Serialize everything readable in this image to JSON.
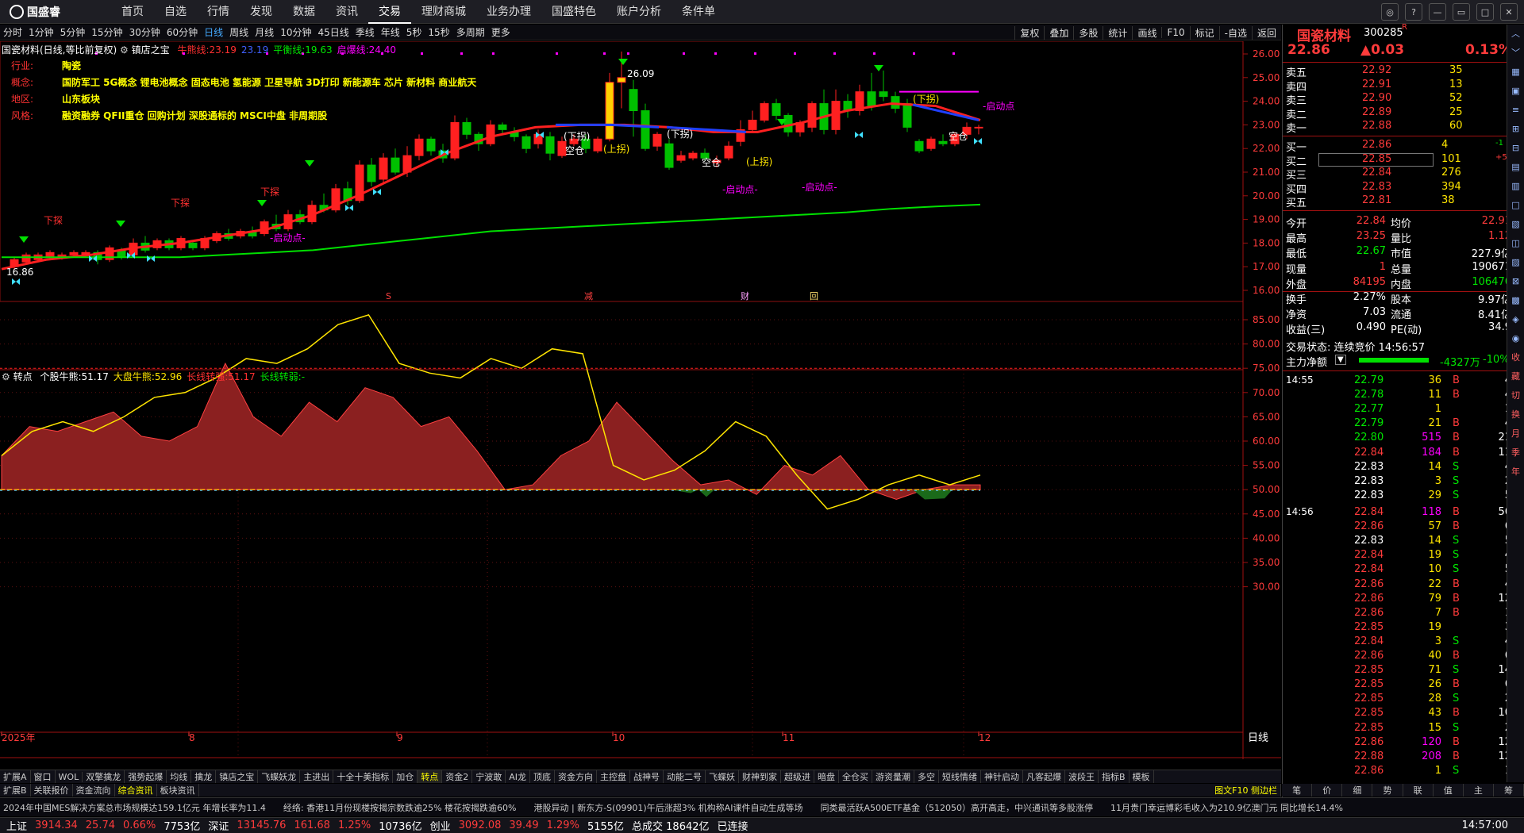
{
  "app": {
    "name": "国盛睿"
  },
  "nav": [
    "首页",
    "自选",
    "行情",
    "发现",
    "数据",
    "资讯",
    "交易",
    "理财商城",
    "业务办理",
    "国盛特色",
    "账户分析",
    "条件单"
  ],
  "nav_active": 6,
  "window_controls": [
    "chat-icon",
    "help-icon",
    "minimize-icon",
    "restore-icon",
    "maximize-icon",
    "close-icon"
  ],
  "periods": [
    "分时",
    "1分钟",
    "5分钟",
    "15分钟",
    "30分钟",
    "60分钟",
    "日线",
    "周线",
    "月线",
    "10分钟",
    "45日线",
    "季线",
    "年线",
    "5秒",
    "15秒",
    "多周期",
    "更多"
  ],
  "period_active": 6,
  "tools": [
    "复权",
    "叠加",
    "多股",
    "统计",
    "画线",
    "F10",
    "标记",
    "-自选",
    "返回"
  ],
  "main_chart": {
    "title": "国瓷材料(日线,等比前复权)",
    "indicator_name": "镇店之宝",
    "legend": [
      {
        "label": "牛熊线:",
        "value": "23.19",
        "color": "#ff3030"
      },
      {
        "label": "",
        "value": "23.19",
        "color": "#4060ff"
      },
      {
        "label": "平衡线:",
        "value": "19.63",
        "color": "#00e600"
      },
      {
        "label": "启爆线:",
        "value": "24.40",
        "color": "#ff00ff"
      }
    ],
    "info": [
      {
        "k": "行业:",
        "v": "陶瓷"
      },
      {
        "k": "概念:",
        "v": "国防军工 5G概念 锂电池概念 固态电池 氢能源 卫星导航 3D打印 新能源车 芯片 新材料 商业航天"
      },
      {
        "k": "地区:",
        "v": "山东板块"
      },
      {
        "k": "风格:",
        "v": "融资融券 QFII重仓 回购计划 深股通标的 MSCI中盘 非周期股"
      }
    ],
    "price_axis": [
      "26.00",
      "25.00",
      "24.00",
      "23.00",
      "22.00",
      "21.00",
      "20.00",
      "19.00",
      "18.00",
      "17.00",
      "16.00"
    ],
    "annotations": [
      "16.86",
      "26.09",
      "(下拐)",
      "(上拐)",
      "(下拐)",
      "(上拐)",
      "空仓",
      "空仓",
      "空仓",
      "-启动点-",
      "-启动点-",
      "-启动点-",
      "-启动点",
      "下探",
      "下探",
      "卖",
      "买",
      "S",
      "B"
    ],
    "event_markers": [
      "S",
      "减",
      "财",
      "回"
    ]
  },
  "sub_chart": {
    "indicator_name": "转点",
    "legend": [
      {
        "label": "个股牛熊:",
        "value": "51.17",
        "color": "#ffffff"
      },
      {
        "label": "大盘牛熊:",
        "value": "52.96",
        "color": "#ffe500"
      },
      {
        "label": "长线转强:",
        "value": "51.17",
        "color": "#ff3030"
      },
      {
        "label": "长线转弱:",
        "value": "-",
        "color": "#00e600"
      }
    ],
    "axis": [
      "85.00",
      "80.00",
      "75.00",
      "70.00",
      "65.00",
      "60.00",
      "55.00",
      "50.00",
      "45.00",
      "40.00",
      "35.00",
      "30.00"
    ]
  },
  "chart_data": {
    "type": "line",
    "title": "国瓷材料(日线,等比前复权)",
    "x": [
      "2025年",
      "8",
      "9",
      "10",
      "11",
      "12"
    ],
    "series": [
      {
        "name": "牛熊线",
        "values": [
          16.9,
          17.3,
          17.5,
          17.8,
          18.0,
          18.3,
          18.6,
          19.2,
          20.0,
          20.9,
          21.8,
          22.5,
          22.9,
          23.0,
          23.0,
          22.9,
          22.7,
          22.7,
          23.1,
          23.6,
          23.9,
          23.8,
          23.2
        ]
      },
      {
        "name": "平衡线",
        "values": [
          17.4,
          17.4,
          17.4,
          17.4,
          17.4,
          17.5,
          17.6,
          17.7,
          17.9,
          18.1,
          18.3,
          18.5,
          18.6,
          18.7,
          18.8,
          18.9,
          19.0,
          19.1,
          19.2,
          19.3,
          19.45,
          19.55,
          19.63
        ]
      }
    ],
    "ylim": [
      15.8,
      26.6
    ],
    "sub": {
      "个股牛熊": [
        57,
        63,
        62,
        64,
        66,
        61,
        60,
        63,
        76,
        65,
        61,
        68,
        64,
        71,
        69,
        63,
        65,
        58,
        50,
        51,
        57,
        60,
        68,
        62,
        56,
        51,
        52,
        49,
        55,
        53,
        57,
        50,
        48,
        50,
        51,
        51
      ],
      "大盘牛熊": [
        57,
        62,
        64,
        62,
        65,
        69,
        70,
        73,
        77,
        76,
        79,
        84,
        86,
        76,
        74,
        73,
        77,
        75,
        79,
        78,
        55,
        52,
        54,
        58,
        64,
        61,
        53,
        46,
        48,
        51,
        53,
        51,
        53
      ]
    }
  },
  "x_axis_labels": [
    "2025年",
    "8",
    "9",
    "10",
    "11",
    "12"
  ],
  "x_axis_right": "日线",
  "quote": {
    "name": "国瓷材料",
    "code": "300285",
    "flags": "R",
    "price": "22.86",
    "change": "▲0.03",
    "pct": "0.13%",
    "sells": [
      {
        "label": "卖五",
        "price": "22.92",
        "vol": "35"
      },
      {
        "label": "卖四",
        "price": "22.91",
        "vol": "13"
      },
      {
        "label": "卖三",
        "price": "22.90",
        "vol": "52"
      },
      {
        "label": "卖二",
        "price": "22.89",
        "vol": "25"
      },
      {
        "label": "卖一",
        "price": "22.88",
        "vol": "60"
      }
    ],
    "buys": [
      {
        "label": "买一",
        "price": "22.86",
        "vol": "4",
        "chg": "-1"
      },
      {
        "label": "买二",
        "price": "22.85",
        "vol": "101",
        "chg": "+5"
      },
      {
        "label": "买三",
        "price": "22.84",
        "vol": "276",
        "chg": ""
      },
      {
        "label": "买四",
        "price": "22.83",
        "vol": "394",
        "chg": ""
      },
      {
        "label": "买五",
        "price": "22.81",
        "vol": "38",
        "chg": ""
      }
    ],
    "stats": [
      {
        "k1": "今开",
        "v1": "22.84",
        "c1": "red",
        "k2": "均价",
        "v2": "22.91",
        "c2": "red"
      },
      {
        "k1": "最高",
        "v1": "23.25",
        "c1": "red",
        "k2": "量比",
        "v2": "1.12",
        "c2": "red"
      },
      {
        "k1": "最低",
        "v1": "22.67",
        "c1": "grn",
        "k2": "市值",
        "v2": "227.9亿",
        "c2": "wht"
      },
      {
        "k1": "现量",
        "v1": "1",
        "c1": "red",
        "k2": "总量",
        "v2": "190671",
        "c2": "wht"
      },
      {
        "k1": "外盘",
        "v1": "84195",
        "c1": "red",
        "k2": "内盘",
        "v2": "106476",
        "c2": "grn"
      },
      {
        "k1": "换手",
        "v1": "2.27%",
        "c1": "wht",
        "k2": "股本",
        "v2": "9.97亿",
        "c2": "wht"
      },
      {
        "k1": "净资",
        "v1": "7.03",
        "c1": "wht",
        "k2": "流通",
        "v2": "8.41亿",
        "c2": "wht"
      },
      {
        "k1": "收益(三)",
        "v1": "0.490",
        "c1": "wht",
        "k2": "PE(动)",
        "v2": "34.9",
        "c2": "wht"
      }
    ],
    "trade_state": "交易状态: 连续竞价 14:56:57",
    "main_net_label": "主力净额",
    "main_net_value": "-4327万",
    "main_net_pct": "-10%"
  },
  "ticks_1455": [
    {
      "p": "22.79",
      "v": "36",
      "d": "B",
      "n": "4",
      "c": "grn"
    },
    {
      "p": "22.78",
      "v": "11",
      "d": "B",
      "n": "4",
      "c": "grn"
    },
    {
      "p": "22.77",
      "v": "1",
      "d": "",
      "n": "1",
      "c": "grn"
    },
    {
      "p": "22.79",
      "v": "21",
      "d": "B",
      "n": "4",
      "c": "grn"
    },
    {
      "p": "22.80",
      "v": "515",
      "d": "B",
      "n": "21",
      "c": "grn"
    },
    {
      "p": "22.84",
      "v": "184",
      "d": "B",
      "n": "11",
      "c": "red"
    },
    {
      "p": "22.83",
      "v": "14",
      "d": "S",
      "n": "4",
      "c": "wht"
    },
    {
      "p": "22.83",
      "v": "3",
      "d": "S",
      "n": "2",
      "c": "wht"
    },
    {
      "p": "22.83",
      "v": "29",
      "d": "S",
      "n": "5",
      "c": "wht"
    }
  ],
  "ticks_1456": [
    {
      "p": "22.84",
      "v": "118",
      "d": "B",
      "n": "56",
      "c": "red"
    },
    {
      "p": "22.86",
      "v": "57",
      "d": "B",
      "n": "6",
      "c": "red"
    },
    {
      "p": "22.83",
      "v": "14",
      "d": "S",
      "n": "5",
      "c": "wht"
    },
    {
      "p": "22.84",
      "v": "19",
      "d": "S",
      "n": "4",
      "c": "red"
    },
    {
      "p": "22.84",
      "v": "10",
      "d": "S",
      "n": "5",
      "c": "red"
    },
    {
      "p": "22.86",
      "v": "22",
      "d": "B",
      "n": "4",
      "c": "red"
    },
    {
      "p": "22.86",
      "v": "79",
      "d": "B",
      "n": "12",
      "c": "red"
    },
    {
      "p": "22.86",
      "v": "7",
      "d": "B",
      "n": "1",
      "c": "red"
    },
    {
      "p": "22.85",
      "v": "19",
      "d": "",
      "n": "3",
      "c": "red"
    },
    {
      "p": "22.84",
      "v": "3",
      "d": "S",
      "n": "4",
      "c": "red"
    },
    {
      "p": "22.86",
      "v": "40",
      "d": "B",
      "n": "6",
      "c": "red"
    },
    {
      "p": "22.85",
      "v": "71",
      "d": "S",
      "n": "14",
      "c": "red"
    },
    {
      "p": "22.85",
      "v": "26",
      "d": "B",
      "n": "6",
      "c": "red"
    },
    {
      "p": "22.85",
      "v": "28",
      "d": "S",
      "n": "2",
      "c": "red"
    },
    {
      "p": "22.85",
      "v": "43",
      "d": "B",
      "n": "10",
      "c": "red"
    },
    {
      "p": "22.85",
      "v": "15",
      "d": "S",
      "n": "2",
      "c": "red"
    },
    {
      "p": "22.86",
      "v": "120",
      "d": "B",
      "n": "12",
      "c": "red"
    },
    {
      "p": "22.88",
      "v": "208",
      "d": "B",
      "n": "12",
      "c": "red"
    },
    {
      "p": "22.86",
      "v": "1",
      "d": "S",
      "n": "1",
      "c": "red"
    }
  ],
  "tick_times": [
    "14:55",
    "14:56"
  ],
  "right_tabs": [
    "笔",
    "价",
    "细",
    "势",
    "联",
    "值",
    "主",
    "筹"
  ],
  "side_icons": [
    "收",
    "藏",
    "切",
    "换",
    "月",
    "季",
    "年"
  ],
  "tabs1": [
    "扩展A",
    "窗口",
    "WOL",
    "双擎擒龙",
    "强势起爆",
    "均线",
    "擒龙",
    "镇店之宝",
    "飞蝶妖龙",
    "主进出",
    "十全十美指标",
    "加仓",
    "转点",
    "资金2",
    "宁波敢",
    "AI龙",
    "顶底",
    "资金方向",
    "主控盘",
    "战神号",
    "动能二号",
    "飞蝶妖",
    "财神到家",
    "超级进",
    "暗盘",
    "全仓买",
    "游资量潮",
    "多空",
    "短线情绪",
    "神针启动",
    "凡客起爆",
    "波段王",
    "指标B",
    "模板"
  ],
  "tabs1_active": 12,
  "tabs2": [
    "扩展B",
    "关联报价",
    "资金流向",
    "综合资讯",
    "板块资讯"
  ],
  "tabs2_right": "图文F10 侧边栏",
  "ticker": [
    "2024年中国MES解决方案总市场规模达159.1亿元 年增长率为11.4",
    "经络: 香港11月份现楼按揭宗数跌逾25% 楼花按揭跌逾60%",
    "港股异动 | 新东方-S(09901)午后涨超3% 机构称AI课件自动生成等场",
    "同类最活跃A500ETF基金（512050）高开高走，中兴通讯等多股涨停",
    "11月贵门幸运博彩毛收入为210.9亿澳门元 同比增长14.4%"
  ],
  "status": [
    {
      "k": "上证",
      "v": "3914.34",
      "c": "25.74",
      "p": "0.66%",
      "a": "7753亿"
    },
    {
      "k": "深证",
      "v": "13145.76",
      "c": "161.68",
      "p": "1.25%",
      "a": "10736亿"
    },
    {
      "k": "创业",
      "v": "3092.08",
      "c": "39.49",
      "p": "1.29%",
      "a": "5155亿"
    }
  ],
  "status_total": "总成交 18642亿",
  "status_conn": "已连接",
  "status_time": "14:57:00"
}
